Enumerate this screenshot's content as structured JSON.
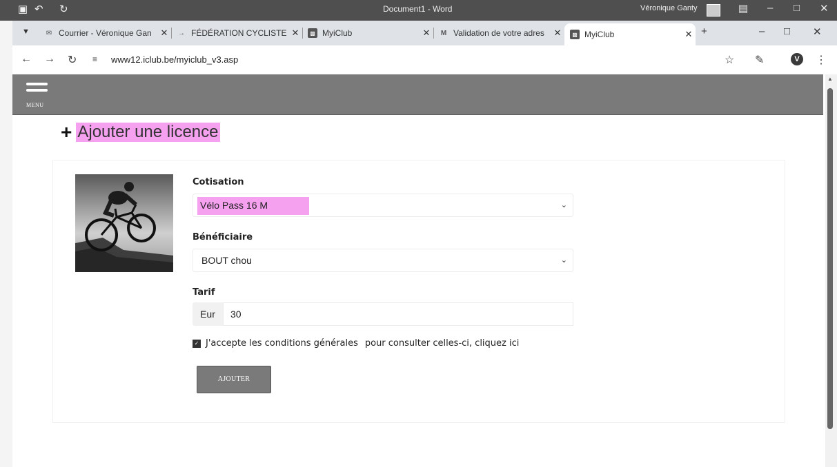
{
  "word": {
    "title": "Document1 - Word",
    "user": "Véronique Ganty"
  },
  "browser": {
    "tabs": [
      {
        "label": "Courrier - Véronique Gan",
        "active": false
      },
      {
        "label": "FÉDÉRATION CYCLISTE W",
        "active": false
      },
      {
        "label": "MyiClub",
        "active": false
      },
      {
        "label": "Validation de votre adres",
        "active": false
      },
      {
        "label": "MyiClub",
        "active": true
      }
    ],
    "url": "www12.iclub.be/myiclub_v3.asp",
    "profile_initial": "V"
  },
  "header": {
    "menu_label": "MENU"
  },
  "page": {
    "title": "Ajouter une licence"
  },
  "form": {
    "cotisation_label": "Cotisation",
    "cotisation_value": "Vélo Pass 16 M",
    "beneficiaire_label": "Bénéficiaire",
    "beneficiaire_value": "BOUT chou",
    "tarif_label": "Tarif",
    "tarif_currency": "Eur",
    "tarif_value": "30",
    "cgv_text": "J'accepte les conditions générales",
    "cgv_link": "pour consulter celles-ci, cliquez ici",
    "cgv_checked": true,
    "submit_label": "AJOUTER"
  },
  "colors": {
    "highlight": "#f6a0f0",
    "header_bg": "#7a7a7a",
    "button_bg": "#7a7a7a"
  }
}
